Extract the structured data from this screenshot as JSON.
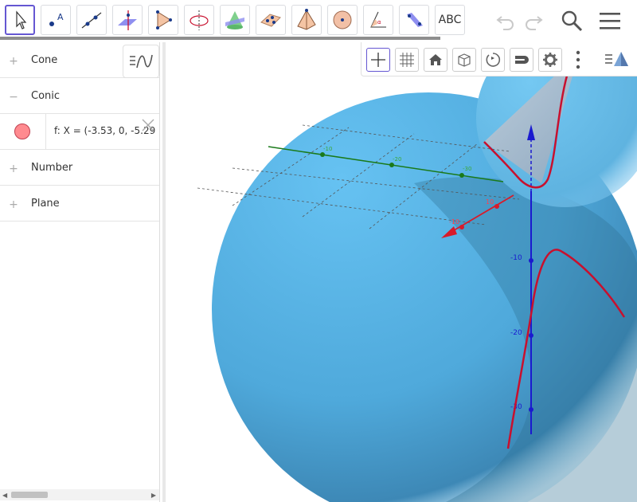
{
  "toolbar": {
    "tools": [
      {
        "name": "move-tool"
      },
      {
        "name": "point-tool"
      },
      {
        "name": "line-tool"
      },
      {
        "name": "perpendicular-tool"
      },
      {
        "name": "polygon-tool"
      },
      {
        "name": "circle-axis-tool"
      },
      {
        "name": "intersect-surfaces-tool"
      },
      {
        "name": "plane-three-points-tool"
      },
      {
        "name": "pyramid-tool"
      },
      {
        "name": "sphere-tool"
      },
      {
        "name": "angle-tool"
      },
      {
        "name": "reflect-plane-tool"
      }
    ],
    "text_tool_label": "ABC"
  },
  "algebra": {
    "groups": [
      {
        "label": "Cone",
        "expanded": false
      },
      {
        "label": "Conic",
        "expanded": true
      },
      {
        "label": "Number",
        "expanded": false
      },
      {
        "label": "Plane",
        "expanded": false
      }
    ],
    "conic_entry": "f: X = (-3.53, 0, -5.29"
  },
  "graphics": {
    "axis_labels": {
      "green": [
        "-10",
        "-20",
        "-30"
      ],
      "red": [
        "10",
        "-10"
      ],
      "blue": [
        "-10",
        "-20",
        "-30"
      ]
    }
  },
  "colors": {
    "accent": "#6557d2",
    "sphere": "#5ab4e6",
    "conic": "#c8102e",
    "x_axis": "#d81b2a",
    "y_axis": "#1a7a1a",
    "z_axis": "#1a1acf"
  }
}
